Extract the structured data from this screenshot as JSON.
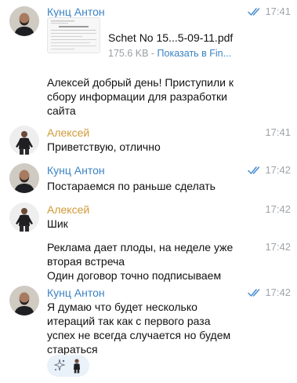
{
  "colors": {
    "sender_anton": "#3a82c4",
    "sender_alexey": "#d09a38",
    "time": "#a0a4a8",
    "read_checks": "#4a8fd0",
    "link": "#3a82c4"
  },
  "messages": [
    {
      "sender": "Кунц Антон",
      "time": "17:41",
      "read": true,
      "file": {
        "name": "Schet No 15...5-09-11.pdf",
        "size": "175.6 KB",
        "separator": " - ",
        "action": "Показать в Fin...",
        "thumb_heading": "ОБРАЗЕЦ ЗАПОЛНЕНИЯ"
      },
      "text": "Алексей добрый день! Приступили к сбору информации для разработки сайта"
    },
    {
      "sender": "Алексей",
      "time": "17:41",
      "text": "Приветствую, отлично"
    },
    {
      "sender": "Кунц Антон",
      "time": "17:42",
      "read": true,
      "text": "Постараемся по раньше сделать"
    },
    {
      "sender": "Алексей",
      "time": "17:42",
      "text": "Шик"
    },
    {
      "sender": "",
      "time": "17:42",
      "text_lines": [
        "Реклама дает плоды, на неделе уже вторая встреча",
        "Один договор точно подписываем"
      ]
    },
    {
      "sender": "Кунц Антон",
      "time": "17:42",
      "read": true,
      "text": "Я думаю что будет несколько итераций так как с первого раза успех не всегда случается но будем стараться",
      "reactions": [
        "sparkle-reaction-icon",
        "person-reaction-icon"
      ]
    }
  ]
}
